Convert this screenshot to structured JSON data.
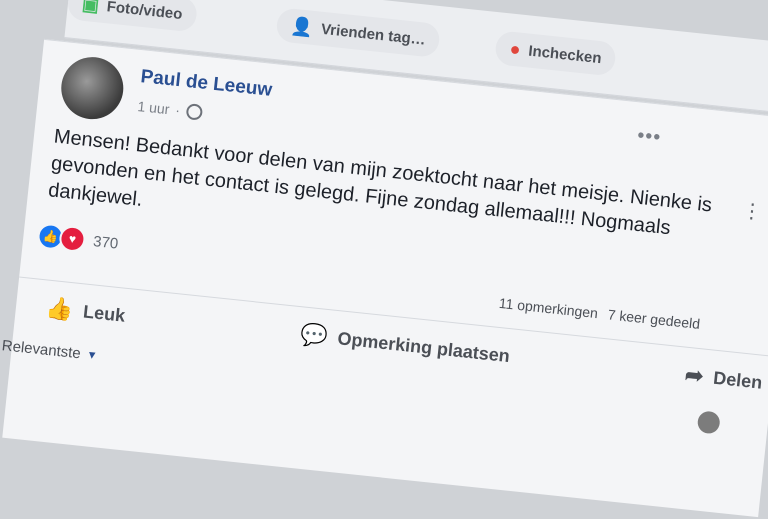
{
  "composer": {
    "photo_video_label": "Foto/video",
    "tag_friends_label": "Vrienden tag…",
    "checkin_label": "Inchecken"
  },
  "post": {
    "author": "Paul de Leeuw",
    "time": "1 uur",
    "time_separator": "·",
    "privacy_icon": "globe-icon",
    "message": "Mensen! Bedankt voor delen van mijn zoektocht naar het meisje. Nienke is gevonden en het contact is gelegd. Fijne zondag allemaal!!! Nogmaals dankjewel.",
    "reaction_count": "370",
    "comments_count": "11 opmerkingen",
    "shares_count": "7 keer gedeeld"
  },
  "actions": {
    "like_label": "Leuk",
    "comment_label": "Opmerking plaatsen",
    "share_label": "Delen"
  },
  "sort": {
    "label": "Relevantste"
  },
  "colors": {
    "author": "#2a4f92",
    "like": "#1877f2",
    "love": "#e41e3f",
    "checkin": "#e0463c"
  }
}
